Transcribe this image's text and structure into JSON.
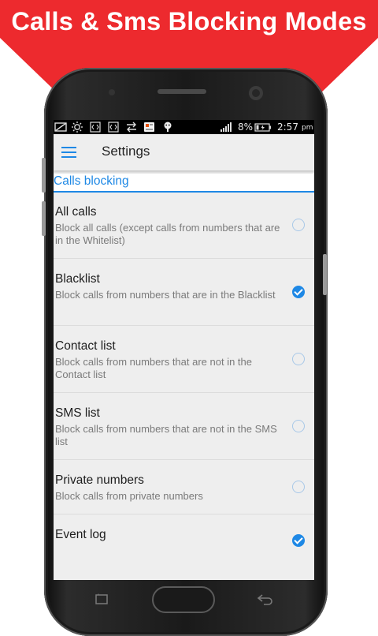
{
  "banner": {
    "title": "Calls & Sms Blocking Modes",
    "color": "#ed2a2e"
  },
  "status_bar": {
    "battery_percent": "8%",
    "time": "2:57",
    "ampm": "pm",
    "icons": [
      "image-icon",
      "brightness-icon",
      "code-icon",
      "code-icon",
      "sync-icon",
      "app-icon",
      "android-icon",
      "signal-icon",
      "battery-icon"
    ]
  },
  "toolbar": {
    "menu_icon": "hamburger-menu-icon",
    "title": "Settings"
  },
  "section": {
    "title": "Calls blocking"
  },
  "preferences": [
    {
      "title": "All calls",
      "summary": "Block all calls (except calls from numbers that are in the Whitelist)",
      "checked": false
    },
    {
      "title": "Blacklist",
      "summary": "Block calls from numbers that are in the Blacklist",
      "checked": true
    },
    {
      "title": "Contact list",
      "summary": "Block calls from numbers that are not in the Contact list",
      "checked": false
    },
    {
      "title": "SMS list",
      "summary": "Block calls from numbers that are not in the SMS list",
      "checked": false
    },
    {
      "title": "Private numbers",
      "summary": "Block calls from private numbers",
      "checked": false
    },
    {
      "title": "Event log",
      "summary": "",
      "checked": true
    }
  ],
  "nav_bar": {
    "recent_icon": "recent-apps-icon",
    "home": "home-button",
    "back_icon": "back-icon"
  },
  "colors": {
    "accent": "#1e88e5",
    "banner": "#ed2a2e",
    "screen_bg": "#eeeeee"
  }
}
